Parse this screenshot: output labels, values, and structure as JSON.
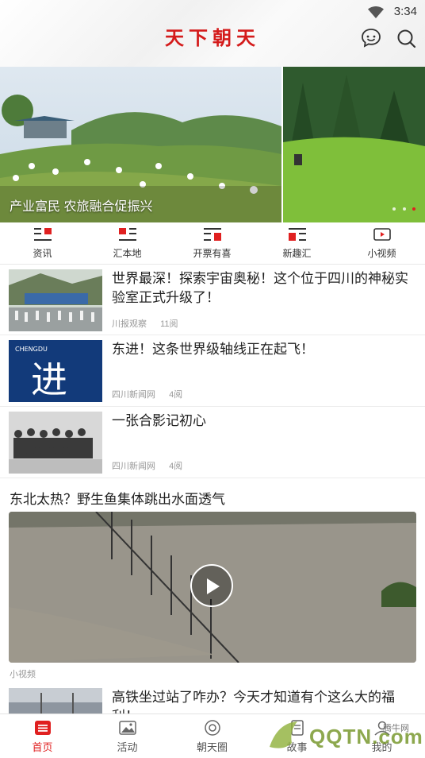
{
  "status": {
    "time": "3:34"
  },
  "header": {
    "logo": "天下朝天"
  },
  "banner": {
    "caption": "产业富民 农旅融合促振兴",
    "slide_count": 3,
    "active_slide": 3
  },
  "categories": [
    {
      "label": "资讯",
      "icon": "news-icon"
    },
    {
      "label": "汇本地",
      "icon": "local-icon"
    },
    {
      "label": "开票有喜",
      "icon": "ticket-icon"
    },
    {
      "label": "新趣汇",
      "icon": "fun-icon"
    },
    {
      "label": "小视频",
      "icon": "video-icon"
    }
  ],
  "news": [
    {
      "title": "世界最深！探索宇宙奥秘！这个位于四川的神秘实验室正式升级了！",
      "source": "川报观察",
      "reads": "11阅"
    },
    {
      "title": "东进！这条世界级轴线正在起飞！",
      "source": "四川新闻网",
      "reads": "4阅"
    },
    {
      "title": "一张合影记初心",
      "source": "四川新闻网",
      "reads": "4阅"
    }
  ],
  "thumb_text": {
    "second_logo": "CHENGDU",
    "second_char": "进"
  },
  "video": {
    "title": "东北太热？野生鱼集体跳出水面透气",
    "tag": "小视频"
  },
  "last_news": {
    "title": "高铁坐过站了咋办？今天才知道有个这么大的福利！"
  },
  "tabs": [
    {
      "label": "首页",
      "icon": "home-icon",
      "active": true
    },
    {
      "label": "活动",
      "icon": "image-icon",
      "active": false
    },
    {
      "label": "朝天圈",
      "icon": "circle-icon",
      "active": false
    },
    {
      "label": "故事",
      "icon": "doc-icon",
      "active": false
    },
    {
      "label": "我的",
      "icon": "user-icon",
      "active": false
    }
  ],
  "watermark": {
    "site": "腾牛网",
    "brand": "QQTN.com"
  },
  "colors": {
    "accent": "#e02020",
    "logo": "#d41b1b"
  }
}
